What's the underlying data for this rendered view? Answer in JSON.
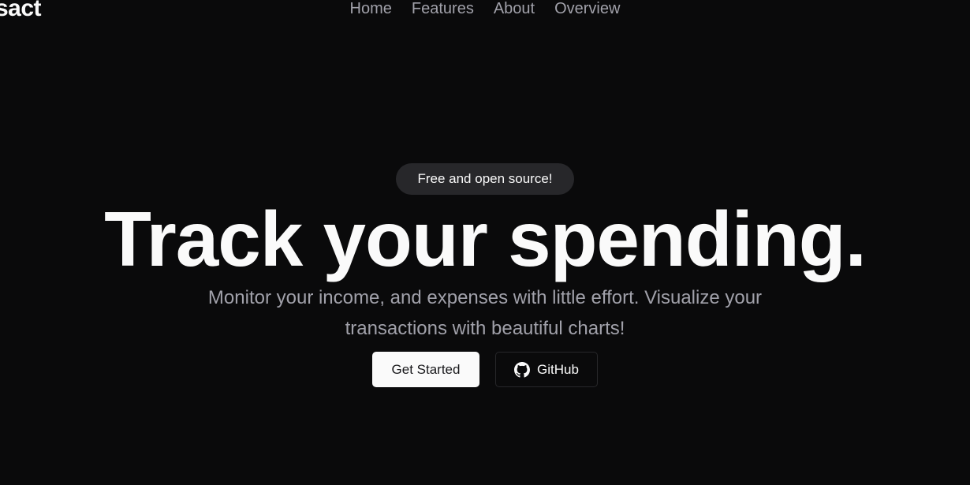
{
  "header": {
    "logo_text": "sact",
    "nav": [
      {
        "label": "Home"
      },
      {
        "label": "Features"
      },
      {
        "label": "About"
      },
      {
        "label": "Overview"
      }
    ]
  },
  "hero": {
    "badge": "Free and open source!",
    "headline": "Track your spending.",
    "subtitle": "Monitor your income, and expenses with little effort. Visualize your transactions with beautiful charts!",
    "primary_button": "Get Started",
    "secondary_button": "GitHub",
    "secondary_button_icon": "github-icon"
  },
  "colors": {
    "background": "#0a0a0b",
    "foreground": "#fafafa",
    "muted": "#a1a1aa",
    "badge_bg": "#27272a"
  }
}
